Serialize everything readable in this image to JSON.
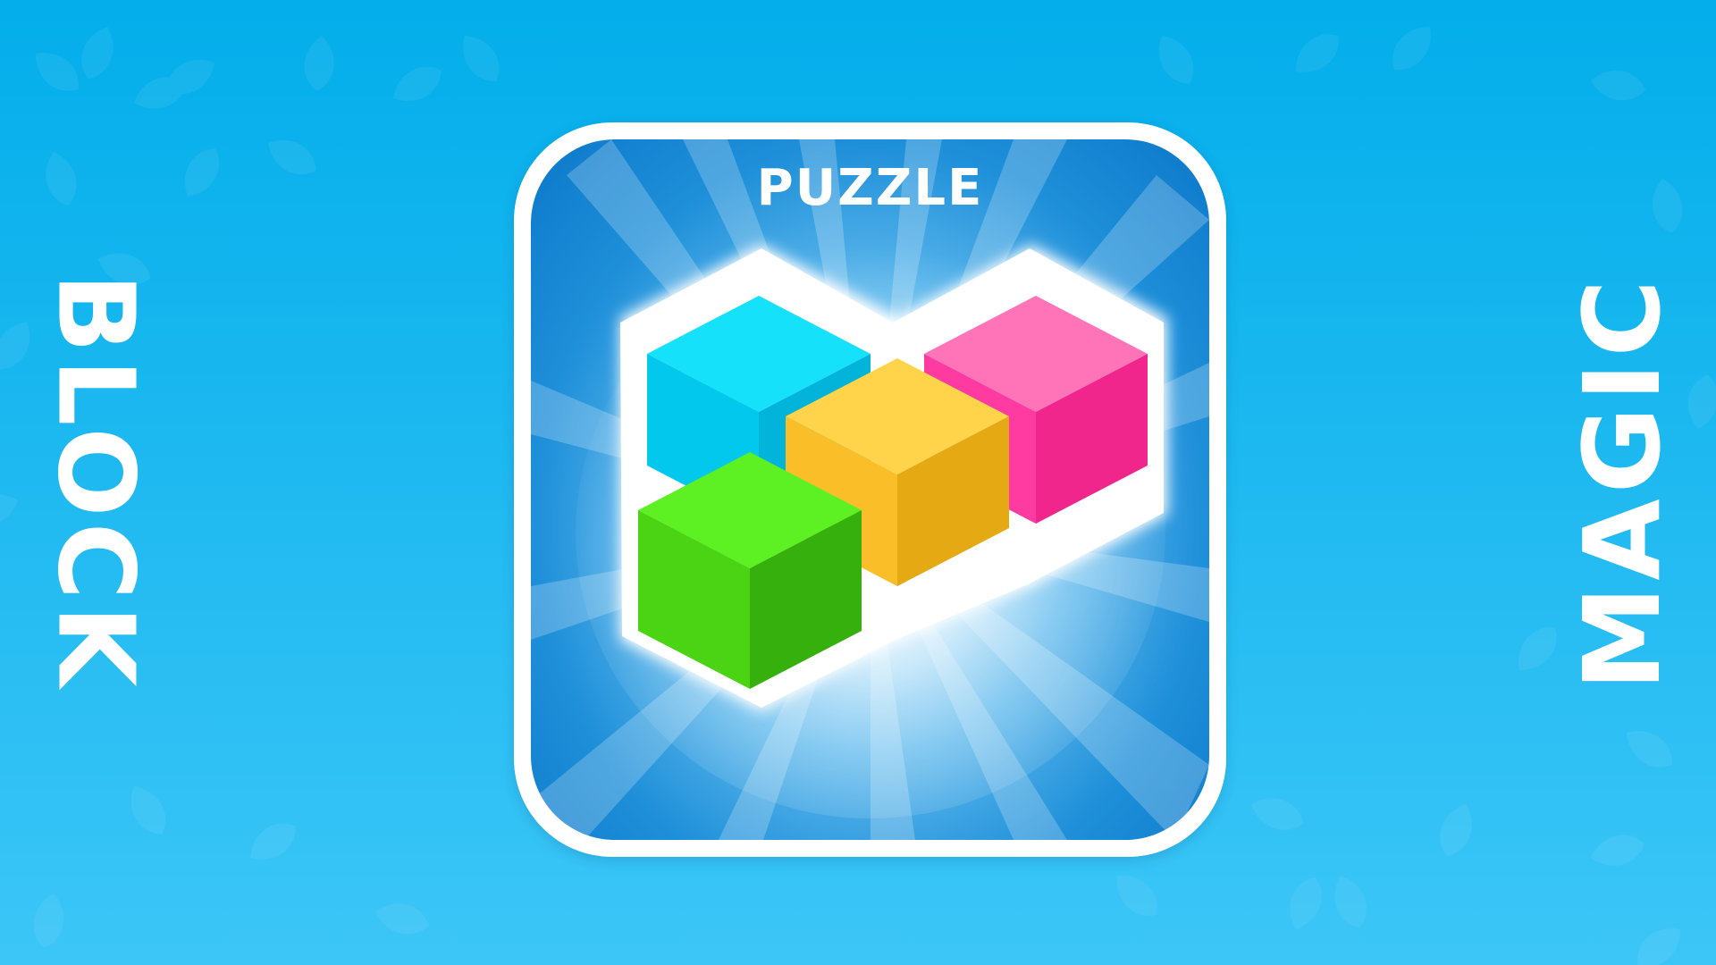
{
  "side_text": {
    "left": "BLOCK",
    "right": "MAGIC"
  },
  "app_icon": {
    "label": "PUZZLE",
    "cubes": [
      {
        "color_name": "cyan",
        "top": "#16e1fb",
        "left": "#03c8ee",
        "right": "#02b4da"
      },
      {
        "color_name": "pink",
        "top": "#ff74b8",
        "left": "#ff3aa0",
        "right": "#f0268c"
      },
      {
        "color_name": "yellow",
        "top": "#ffd44a",
        "left": "#f9be28",
        "right": "#e5a913"
      },
      {
        "color_name": "green",
        "top": "#5df022",
        "left": "#4bd414",
        "right": "#35b00c"
      }
    ]
  },
  "colors": {
    "background_top": "#03aeea",
    "background_bottom": "#3cc6f7",
    "frame": "#ffffff",
    "text": "#ffffff"
  }
}
